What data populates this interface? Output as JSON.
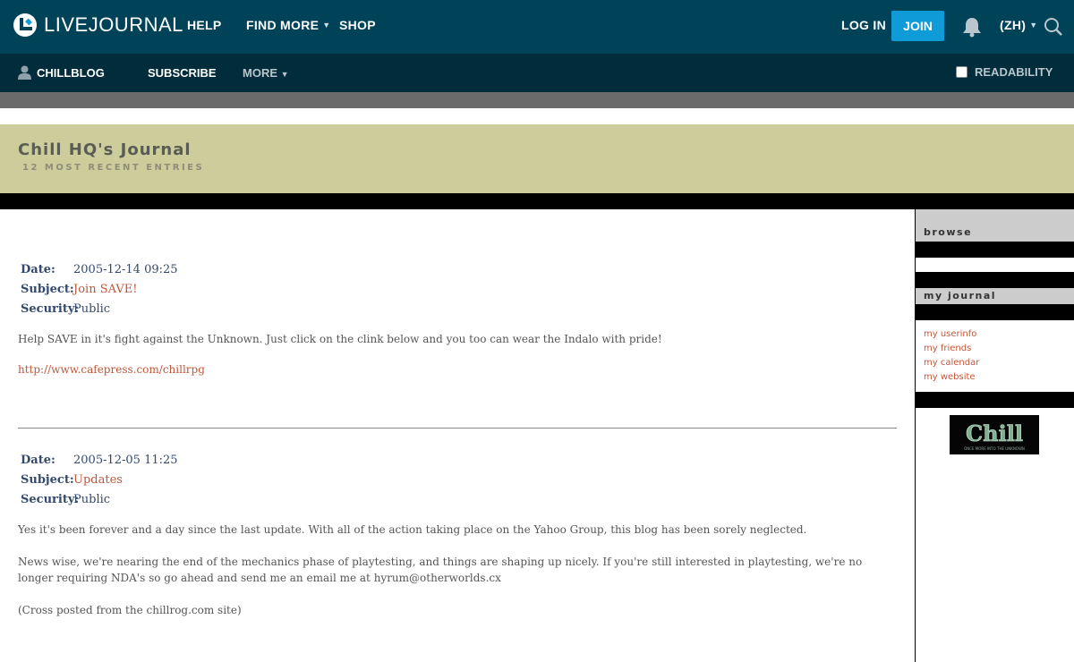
{
  "topnav": {
    "logo_text": "LIVEJOURNAL",
    "help": "HELP",
    "find_more": "FIND MORE",
    "shop": "SHOP",
    "login": "LOG IN",
    "join": "JOIN",
    "language": "(ZH)",
    "icons": [
      "livejournal-logo-icon",
      "chevron-down-icon",
      "bell-icon",
      "search-icon"
    ]
  },
  "subnav": {
    "username": "CHILLBLOG",
    "subscribe": "SUBSCRIBE",
    "more": "MORE",
    "readability": "READABILITY",
    "readability_checked": false,
    "icons": [
      "user-icon",
      "chevron-down-icon"
    ]
  },
  "journal": {
    "title": "Chill HQ's Journal",
    "subtitle": "12 MOST RECENT ENTRIES"
  },
  "labels": {
    "date": "Date:",
    "subject": "Subject:",
    "security": "Security:"
  },
  "entries": [
    {
      "date": "2005-12-14 09:25",
      "subject": "Join SAVE!",
      "security": "Public",
      "body": "Help SAVE in it's fight against the Unknown. Just click on the clink below and you too can wear the Indalo with pride!",
      "link": "http://www.cafepress.com/chillrpg"
    },
    {
      "date": "2005-12-05 11:25",
      "subject": "Updates",
      "security": "Public",
      "body1": "Yes it's been forever and a day since the last update. With all of the action taking place on the Yahoo Group, this blog has been sorely neglected.",
      "body2": "News wise, we're nearing the end of the mechanics phase of playtesting, and things are shaping up nicely. If you're still interested in playtesting, we're no longer requiring NDA's so go ahead and send me an email me at hyrum@otherworlds.cx",
      "body3": "(Cross posted from the chillrog.com site)"
    }
  ],
  "sidebar": {
    "browse": "browse",
    "my_journal": "my journal",
    "links": [
      "my userinfo",
      "my friends",
      "my calendar",
      "my website"
    ],
    "logo_text": "Chill",
    "logo_tagline": "ONCE MORE INTO THE UNKNOWN"
  },
  "colors": {
    "topbar": "#004359",
    "subbar": "#002c3b",
    "join_button": "#0f9bd7",
    "header_band": "#cdcc9b",
    "link": "#c0573a",
    "meta_text": "#344a6c"
  }
}
